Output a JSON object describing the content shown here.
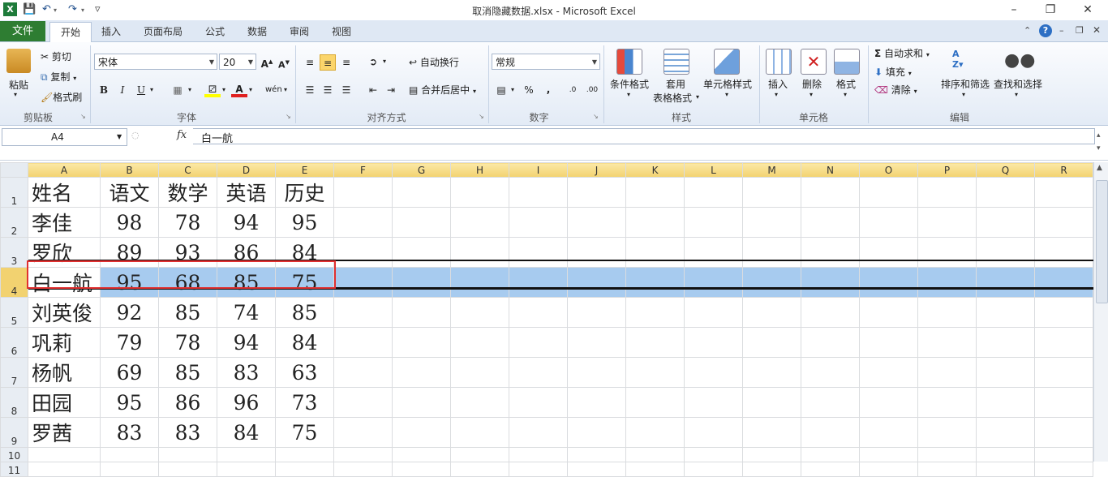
{
  "window": {
    "title": "取消隐藏数据.xlsx - Microsoft Excel",
    "excel_icon": "excel-icon",
    "colors": {
      "accent_file_tab": "#2e7d32",
      "selection_fill": "#a7cbef",
      "highlight_border": "#e03030"
    }
  },
  "ribbon": {
    "tabs": [
      "文件",
      "开始",
      "插入",
      "页面布局",
      "公式",
      "数据",
      "审阅",
      "视图"
    ],
    "active_tab": "开始",
    "clipboard": {
      "paste": "粘贴",
      "cut": "剪切",
      "copy": "复制",
      "format_painter": "格式刷",
      "group": "剪贴板"
    },
    "font": {
      "name": "宋体",
      "size": "20",
      "bold": "B",
      "italic": "I",
      "underline": "U",
      "group": "字体",
      "phonetic": "wén"
    },
    "alignment": {
      "wrap": "自动换行",
      "merge": "合并后居中",
      "group": "对齐方式"
    },
    "number": {
      "format": "常规",
      "percent": "%",
      "comma": ",",
      "group": "数字"
    },
    "styles": {
      "conditional": "条件格式",
      "table1": "套用",
      "table2": "表格格式",
      "cell_styles": "单元格样式",
      "group": "样式"
    },
    "cells": {
      "insert": "插入",
      "delete": "删除",
      "format": "格式",
      "group": "单元格"
    },
    "editing": {
      "autosum": "自动求和",
      "fill": "填充",
      "clear": "清除",
      "sort": "排序和筛选",
      "find": "查找和选择",
      "group": "编辑"
    }
  },
  "formula_bar": {
    "name_box": "A4",
    "fx": "fx",
    "value": "白一航"
  },
  "sheet": {
    "columns": [
      "A",
      "B",
      "C",
      "D",
      "E",
      "F",
      "G",
      "H",
      "I",
      "J",
      "K",
      "L",
      "M",
      "N",
      "O",
      "P",
      "Q",
      "R"
    ],
    "rows": [
      {
        "num": "1",
        "cells": [
          "姓名",
          "语文",
          "数学",
          "英语",
          "历史"
        ]
      },
      {
        "num": "2",
        "cells": [
          "李佳",
          "98",
          "78",
          "94",
          "95"
        ]
      },
      {
        "num": "3",
        "cells": [
          "罗欣",
          "89",
          "93",
          "86",
          "84"
        ]
      },
      {
        "num": "4",
        "cells": [
          "白一航",
          "95",
          "68",
          "85",
          "75"
        ]
      },
      {
        "num": "5",
        "cells": [
          "刘英俊",
          "92",
          "85",
          "74",
          "85"
        ]
      },
      {
        "num": "6",
        "cells": [
          "巩莉",
          "79",
          "78",
          "94",
          "84"
        ]
      },
      {
        "num": "7",
        "cells": [
          "杨帆",
          "69",
          "85",
          "83",
          "63"
        ]
      },
      {
        "num": "8",
        "cells": [
          "田园",
          "95",
          "86",
          "96",
          "73"
        ]
      },
      {
        "num": "9",
        "cells": [
          "罗茜",
          "83",
          "83",
          "84",
          "75"
        ]
      },
      {
        "num": "10",
        "cells": []
      },
      {
        "num": "11",
        "cells": []
      }
    ],
    "selected_row": "4"
  }
}
